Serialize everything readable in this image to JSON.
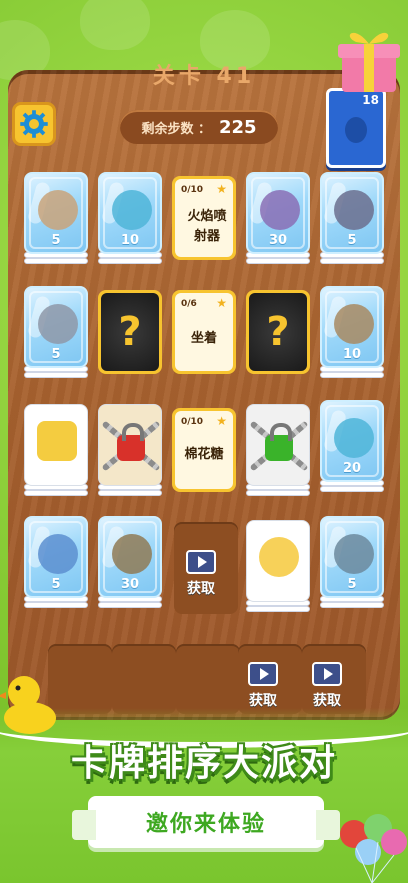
{
  "game": {
    "level_label": "关卡 41",
    "steps_label": "剩余步数 ：",
    "steps_value": "225",
    "deck_count": "18"
  },
  "grid": {
    "row1": [
      {
        "type": "ice",
        "toy": "frog-blaster",
        "count": "5"
      },
      {
        "type": "ice",
        "toy": "hippo",
        "count": "10"
      },
      {
        "type": "quest",
        "progress": "0/10",
        "name": "火焰喷射器"
      },
      {
        "type": "ice",
        "toy": "dragon",
        "count": "30"
      },
      {
        "type": "ice",
        "toy": "wizard-blaster",
        "count": "5"
      }
    ],
    "row2": [
      {
        "type": "ice",
        "toy": "robot-blaster",
        "count": "5"
      },
      {
        "type": "mystery",
        "symbol": "?"
      },
      {
        "type": "quest",
        "progress": "0/6",
        "name": "坐着"
      },
      {
        "type": "mystery",
        "symbol": "?"
      },
      {
        "type": "ice",
        "toy": "explorer",
        "count": "10"
      }
    ],
    "row3": [
      {
        "type": "card",
        "toy": "yellow-excavator"
      },
      {
        "type": "locked",
        "lock_color": "red"
      },
      {
        "type": "quest",
        "progress": "0/10",
        "name": "棉花糖"
      },
      {
        "type": "locked",
        "lock_color": "green"
      },
      {
        "type": "ice",
        "toy": "hippo",
        "count": "20"
      }
    ],
    "row4": [
      {
        "type": "ice",
        "toy": "robot",
        "count": "5"
      },
      {
        "type": "ice",
        "toy": "cowboy",
        "count": "30"
      },
      {
        "type": "get",
        "label": "获取"
      },
      {
        "type": "card",
        "toy": "chick-blaster"
      },
      {
        "type": "ice",
        "toy": "knight-blaster",
        "count": "5"
      }
    ]
  },
  "tray": {
    "get_label_1": "获取",
    "get_label_2": "获取"
  },
  "promo": {
    "title": "卡牌排序大派对",
    "subtitle": "邀你来体验"
  }
}
